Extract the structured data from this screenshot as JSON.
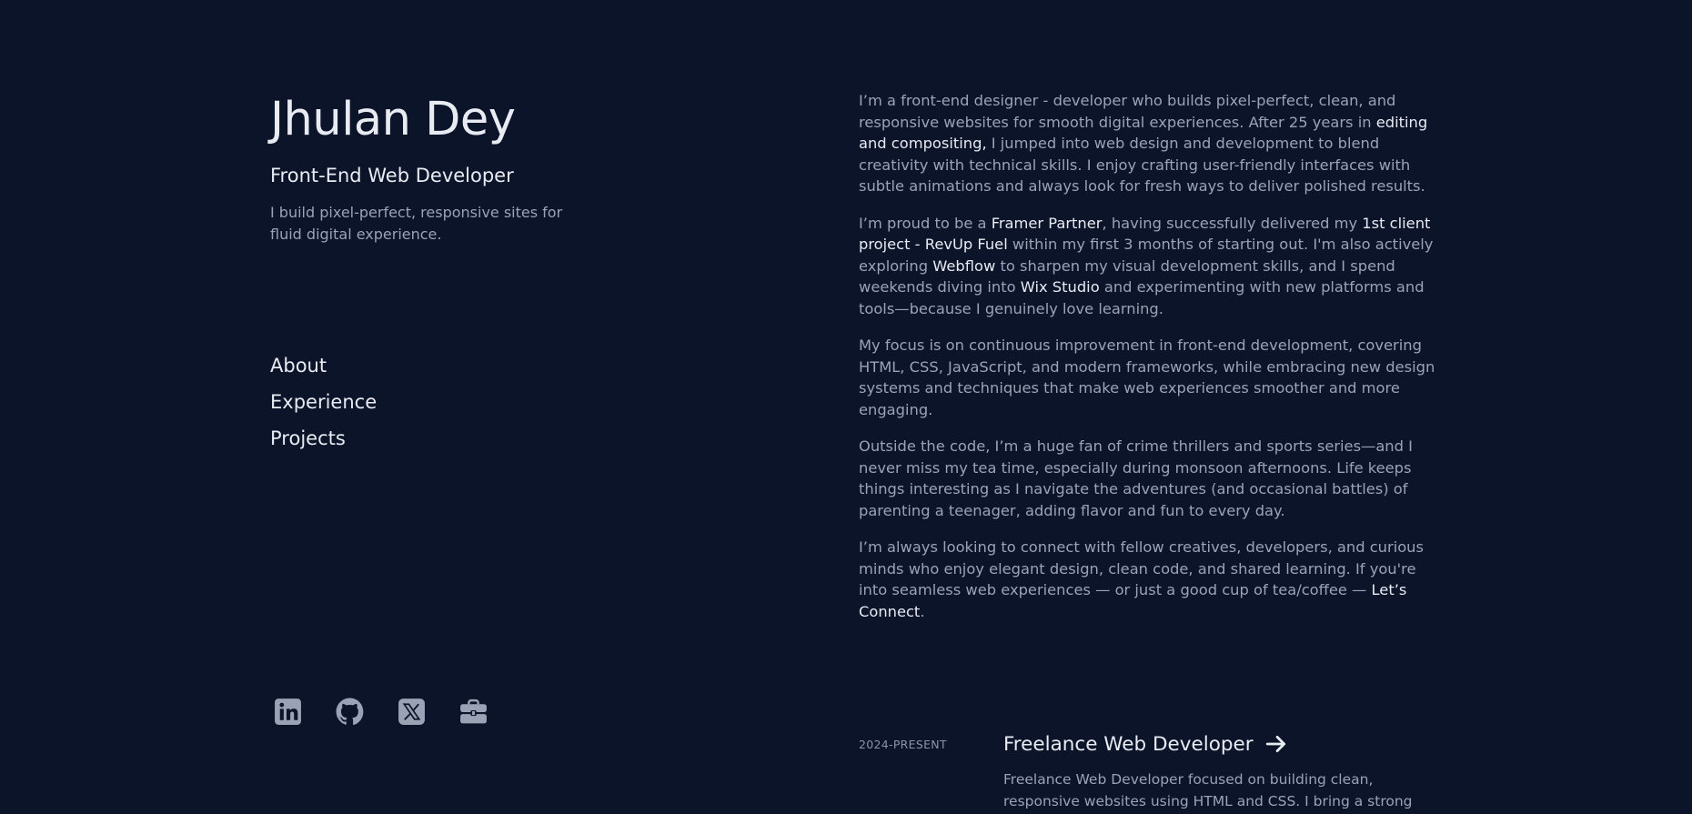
{
  "profile": {
    "name": "Jhulan Dey",
    "role": "Front-End Web Developer",
    "tagline": "I build pixel-perfect, responsive sites for fluid digital experience."
  },
  "nav": {
    "items": [
      {
        "label": "About"
      },
      {
        "label": "Experience"
      },
      {
        "label": "Projects"
      }
    ]
  },
  "socials": [
    {
      "icon": "linkedin-icon"
    },
    {
      "icon": "github-icon"
    },
    {
      "icon": "x-twitter-icon"
    },
    {
      "icon": "briefcase-icon"
    }
  ],
  "about": {
    "p1": {
      "a": "I’m a front-end designer - developer who builds pixel-perfect, clean, and responsive websites for smooth digital experiences. After 25 years in ",
      "b": "editing and compositing,",
      "c": " I jumped into web design and development to blend creativity with technical skills. I enjoy crafting user-friendly interfaces with subtle animations and always look for fresh ways to deliver polished results."
    },
    "p2": {
      "a": "I’m proud to be a ",
      "b": "Framer Partner",
      "c": ", having successfully delivered my ",
      "d": "1st client project - RevUp Fuel",
      "e": " within my first 3 months of starting out. I'm also actively exploring ",
      "f": "Webflow",
      "g": " to sharpen my visual development skills, and I spend weekends diving into ",
      "h": "Wix Studio",
      "i": " and experimenting with new platforms and tools—because I genuinely love learning."
    },
    "p3": "My focus is on continuous improvement in front-end development, covering HTML, CSS, JavaScript, and modern frameworks, while embracing new design systems and techniques that make web experiences smoother and more engaging.",
    "p4": "Outside the code, I’m a huge fan of crime thrillers and sports series—and I never miss my tea time, especially during monsoon afternoons. Life keeps things interesting as I navigate the adventures (and occasional battles) of parenting a teenager, adding flavor and fun to every day.",
    "p5": {
      "a": "I’m always looking to connect with fellow creatives, developers, and curious minds who enjoy elegant design, clean code, and shared learning. If you're into seamless web experiences — or just a good cup of tea/coffee — ",
      "link": "Let’s Connect",
      "end": "."
    }
  },
  "experience": {
    "date": "2024-PRESENT",
    "title": "Freelance Web Developer",
    "desc": "Freelance Web Developer focused on building clean, responsive websites using HTML and CSS. I bring a strong eye"
  },
  "colors": {
    "background": "#0c142a",
    "heading": "#e8ebf2",
    "body": "#9aa3b5"
  }
}
